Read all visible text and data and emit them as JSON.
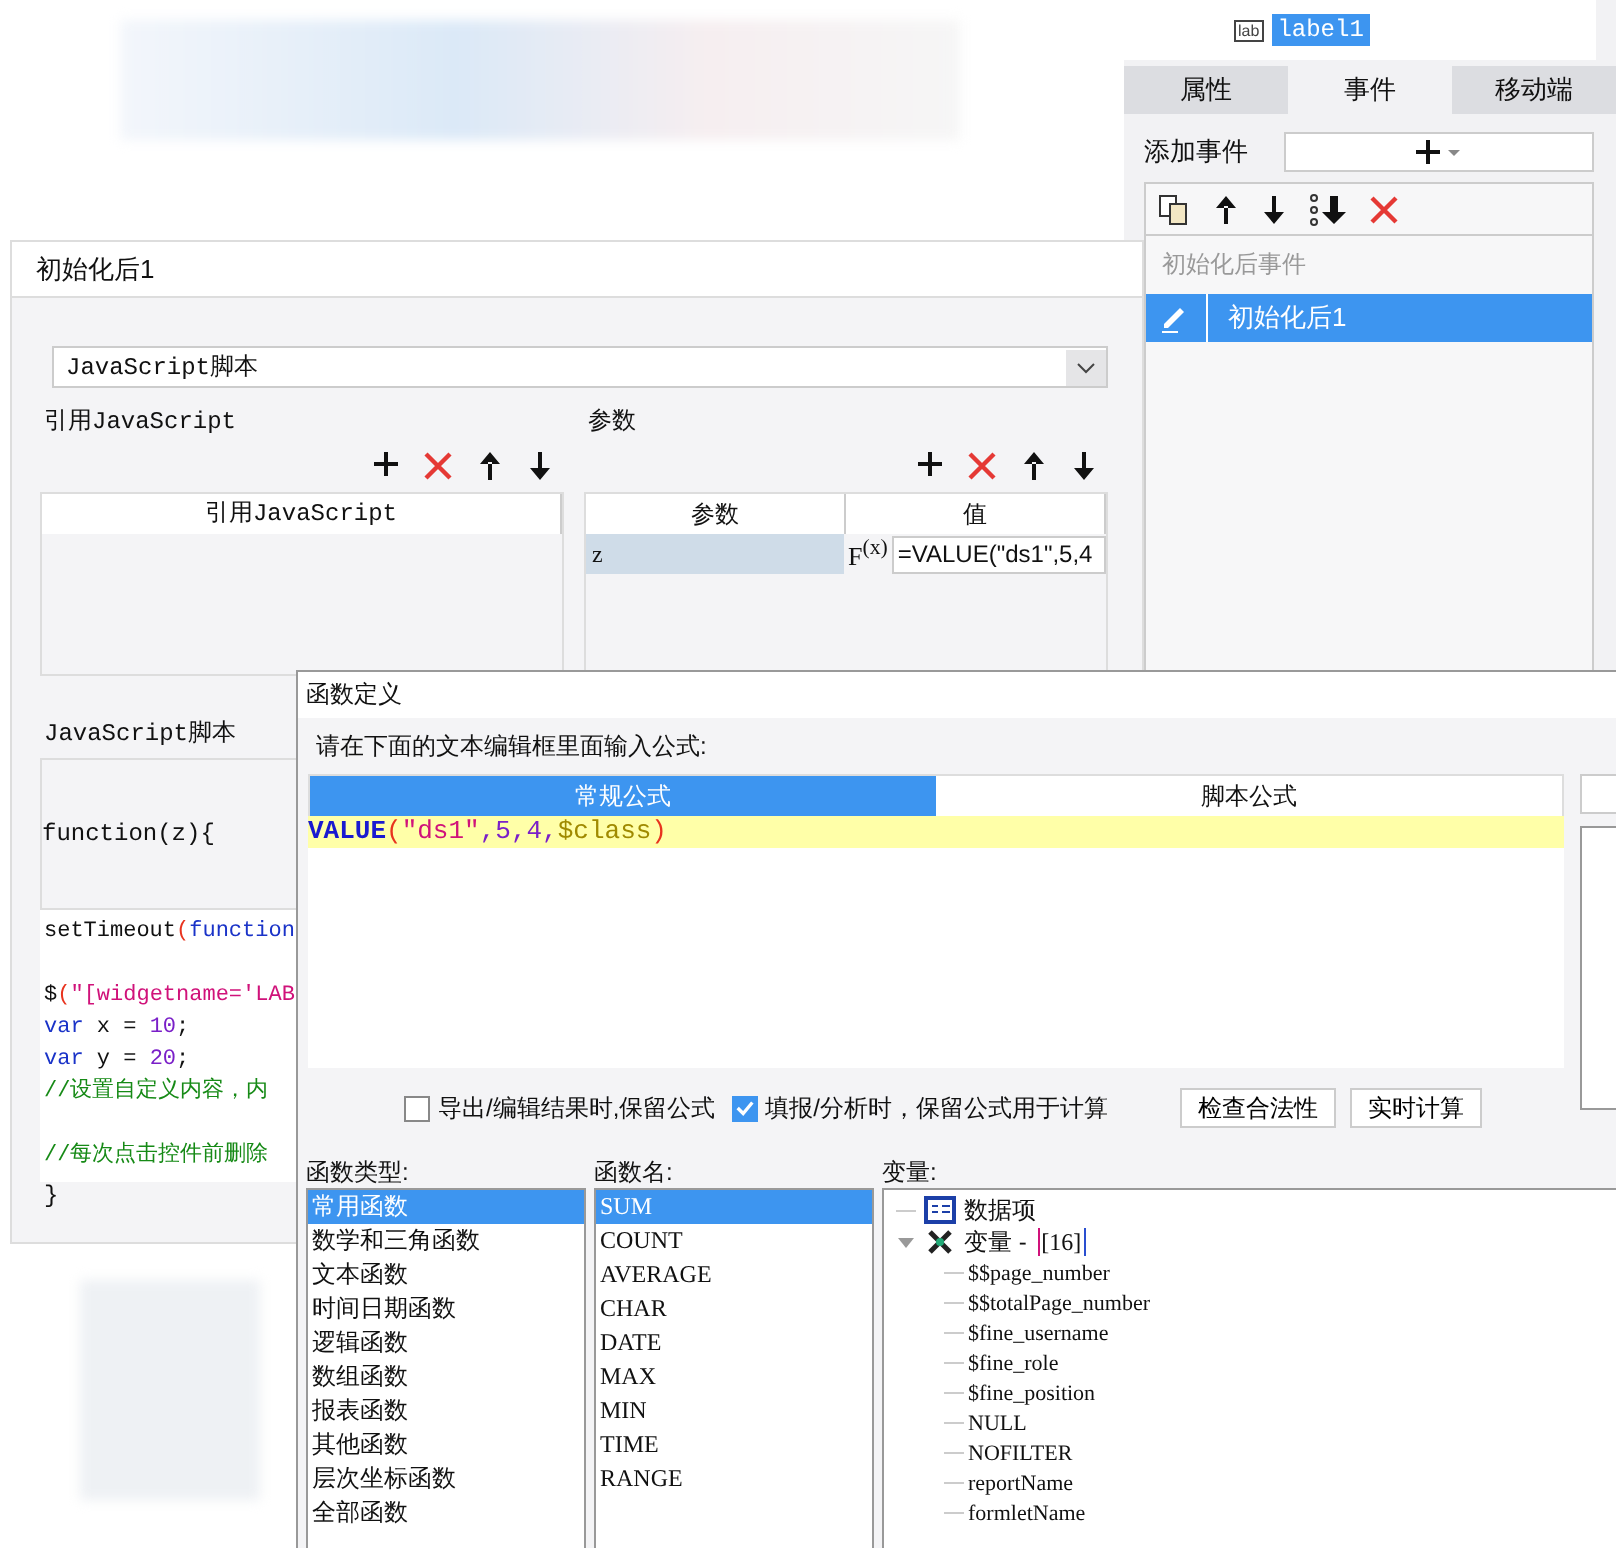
{
  "side_panel": {
    "tree_icon_text": "lab",
    "tree_item": "label1",
    "tabs": [
      {
        "label": "属性",
        "selected": false
      },
      {
        "label": "事件",
        "selected": true
      },
      {
        "label": "移动端",
        "selected": false
      }
    ],
    "add_event_label": "添加事件",
    "event_list_header": "初始化后事件",
    "events": [
      {
        "label": "初始化后1",
        "selected": true
      }
    ]
  },
  "event_dialog": {
    "title": "初始化后1",
    "script_type": "JavaScript脚本",
    "ref_section": "引用JavaScript",
    "ref_columns": [
      "引用JavaScript"
    ],
    "param_section": "参数",
    "param_columns": [
      "参数",
      "值"
    ],
    "param_rows": [
      {
        "name": "z",
        "fx": "F$^{(x)}$",
        "value": "=VALUE(\"ds1\",5,4",
        "selected": true
      }
    ],
    "script_section": "JavaScript脚本",
    "function_header": "function(z){",
    "code_lines": [
      {
        "gap_before": false,
        "segments": [
          {
            "kind": "plain",
            "text": "setTimeout"
          },
          {
            "kind": "paren",
            "text": "("
          },
          {
            "kind": "keyword",
            "text": "function"
          }
        ]
      },
      {
        "gap_before": true,
        "segments": [
          {
            "kind": "plain",
            "text": "$"
          },
          {
            "kind": "paren",
            "text": "("
          },
          {
            "kind": "string",
            "text": "\"[widgetname='LAB"
          }
        ]
      },
      {
        "gap_before": false,
        "segments": [
          {
            "kind": "keyword",
            "text": "var"
          },
          {
            "kind": "plain",
            "text": " x = "
          },
          {
            "kind": "number",
            "text": "10"
          },
          {
            "kind": "plain",
            "text": ";"
          }
        ]
      },
      {
        "gap_before": false,
        "segments": [
          {
            "kind": "keyword",
            "text": "var"
          },
          {
            "kind": "plain",
            "text": " y = "
          },
          {
            "kind": "number",
            "text": "20"
          },
          {
            "kind": "plain",
            "text": ";"
          }
        ]
      },
      {
        "gap_before": false,
        "segments": [
          {
            "kind": "comment",
            "text": "//设置自定义内容，内"
          }
        ]
      },
      {
        "gap_before": true,
        "segments": [
          {
            "kind": "comment",
            "text": "//每次点击控件前删除"
          }
        ]
      }
    ],
    "closing": "}"
  },
  "function_dialog": {
    "title": "函数定义",
    "instruction": "请在下面的文本编辑框里面输入公式:",
    "tabs": [
      {
        "label": "常规公式",
        "selected": true
      },
      {
        "label": "脚本公式",
        "selected": false
      }
    ],
    "formula": [
      {
        "kind": "function",
        "text": "VALUE"
      },
      {
        "kind": "paren",
        "text": "("
      },
      {
        "kind": "string",
        "text": "\"ds1\""
      },
      {
        "kind": "number",
        "text": ",5,4,"
      },
      {
        "kind": "variable",
        "text": "$class"
      },
      {
        "kind": "paren",
        "text": ")"
      }
    ],
    "options": [
      {
        "label": "导出/编辑结果时,保留公式",
        "checked": false
      },
      {
        "label": "填报/分析时，保留公式用于计算",
        "checked": true
      }
    ],
    "buttons": [
      "检查合法性",
      "实时计算"
    ],
    "types_label": "函数类型:",
    "types": [
      {
        "label": "常用函数",
        "selected": true
      },
      {
        "label": "数学和三角函数",
        "selected": false
      },
      {
        "label": "文本函数",
        "selected": false
      },
      {
        "label": "时间日期函数",
        "selected": false
      },
      {
        "label": "逻辑函数",
        "selected": false
      },
      {
        "label": "数组函数",
        "selected": false
      },
      {
        "label": "报表函数",
        "selected": false
      },
      {
        "label": "其他函数",
        "selected": false
      },
      {
        "label": "层次坐标函数",
        "selected": false
      },
      {
        "label": "全部函数",
        "selected": false
      }
    ],
    "names_label": "函数名:",
    "names": [
      {
        "label": "SUM",
        "selected": true
      },
      {
        "label": "COUNT",
        "selected": false
      },
      {
        "label": "AVERAGE",
        "selected": false
      },
      {
        "label": "CHAR",
        "selected": false
      },
      {
        "label": "DATE",
        "selected": false
      },
      {
        "label": "MAX",
        "selected": false
      },
      {
        "label": "MIN",
        "selected": false
      },
      {
        "label": "TIME",
        "selected": false
      },
      {
        "label": "RANGE",
        "selected": false
      }
    ],
    "variables_label": "变量:",
    "variables": [
      {
        "kind": "data",
        "label": "数据项",
        "expanded": false
      },
      {
        "kind": "group",
        "label": "变量 - ",
        "count": "[16]",
        "expanded": true,
        "children": [
          {
            "label": "$$page_number"
          },
          {
            "label": "$$totalPage_number"
          },
          {
            "label": "$fine_username"
          },
          {
            "label": "$fine_role"
          },
          {
            "label": "$fine_position"
          },
          {
            "label": "NULL"
          },
          {
            "label": "NOFILTER"
          },
          {
            "label": "reportName"
          },
          {
            "label": "formletName"
          }
        ]
      }
    ]
  }
}
